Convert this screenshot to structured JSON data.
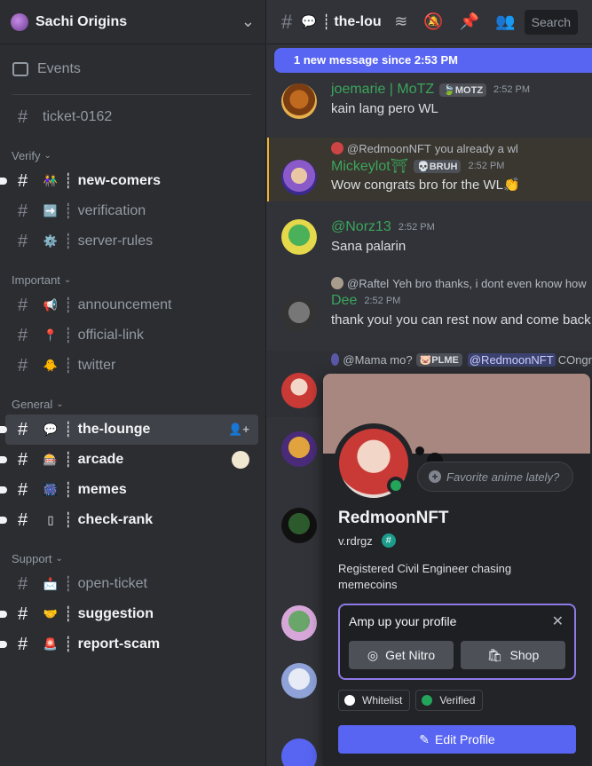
{
  "server": {
    "name": "Sachi Origins"
  },
  "sidebar": {
    "events_label": "Events",
    "ticket": {
      "name": "ticket-0162"
    },
    "categories": [
      {
        "label": "Verify",
        "channels": [
          {
            "emoji": "👫",
            "name": "new-comers",
            "unread": true
          },
          {
            "emoji": "➡️",
            "name": "verification",
            "unread": false
          },
          {
            "emoji": "⚙️",
            "name": "server-rules",
            "unread": false
          }
        ]
      },
      {
        "label": "Important",
        "channels": [
          {
            "emoji": "📢",
            "name": "announcement",
            "unread": false
          },
          {
            "emoji": "📍",
            "name": "official-link",
            "unread": false
          },
          {
            "emoji": "🐥",
            "name": "twitter",
            "unread": false
          }
        ]
      },
      {
        "label": "General",
        "channels": [
          {
            "emoji": "💬",
            "name": "the-lounge",
            "unread": true,
            "active": true
          },
          {
            "emoji": "🎰",
            "name": "arcade",
            "unread": true
          },
          {
            "emoji": "🎆",
            "name": "memes",
            "unread": true
          },
          {
            "emoji": "▯",
            "name": "check-rank",
            "unread": true
          }
        ]
      },
      {
        "label": "Support",
        "channels": [
          {
            "emoji": "📩",
            "name": "open-ticket",
            "unread": false
          },
          {
            "emoji": "🤝",
            "name": "suggestion",
            "unread": true
          },
          {
            "emoji": "🚨",
            "name": "report-scam",
            "unread": true
          }
        ]
      }
    ]
  },
  "header": {
    "channel_emoji": "💬",
    "channel_name": "the-lounge",
    "search_placeholder": "Search"
  },
  "new_messages_bar": "1 new message since 2:53 PM",
  "messages": [
    {
      "reply": null,
      "author": "joemarie | MoTZ",
      "author_color": "#3ba55c",
      "tag": "🍃MOTZ",
      "time": "2:52 PM",
      "text": "kain lang pero WL"
    },
    {
      "reply_name": "@RedmoonNFT",
      "reply_text": "you already a wl",
      "author": "Mickeylot⛩",
      "author_color": "#3ba55c",
      "tag": "💀BRUH",
      "time": "2:52 PM",
      "text": "Wow congrats bro for the WL👏"
    },
    {
      "reply": null,
      "author": "@Norz13",
      "author_color": "#3ba55c",
      "tag": "",
      "time": "2:52 PM",
      "text": "Sana palarin"
    },
    {
      "reply_name": "@Raftel",
      "reply_text": "Yeh bro thanks, i dont even know how",
      "author": "Dee",
      "author_color": "#3ba55c",
      "tag": "",
      "time": "2:52 PM",
      "text": "thank you! you can rest now and come back"
    },
    {
      "reply_name": "@Mama mo?",
      "reply_tag": "🐷PLME",
      "reply_mention": "@RedmoonNFT",
      "reply_text": "COngr"
    }
  ],
  "profile": {
    "display_name": "RedmoonNFT",
    "username": "v.rdrgz",
    "custom_status": "Favorite anime lately?",
    "bio": "Registered Civil Engineer chasing memecoins",
    "nitro_prompt": "Amp up your profile",
    "get_nitro_label": "Get Nitro",
    "shop_label": "Shop",
    "roles": [
      {
        "name": "Whitelist",
        "color": "#ffffff"
      },
      {
        "name": "Verified",
        "color": "#23a55a"
      }
    ],
    "edit_profile_label": "Edit Profile"
  }
}
